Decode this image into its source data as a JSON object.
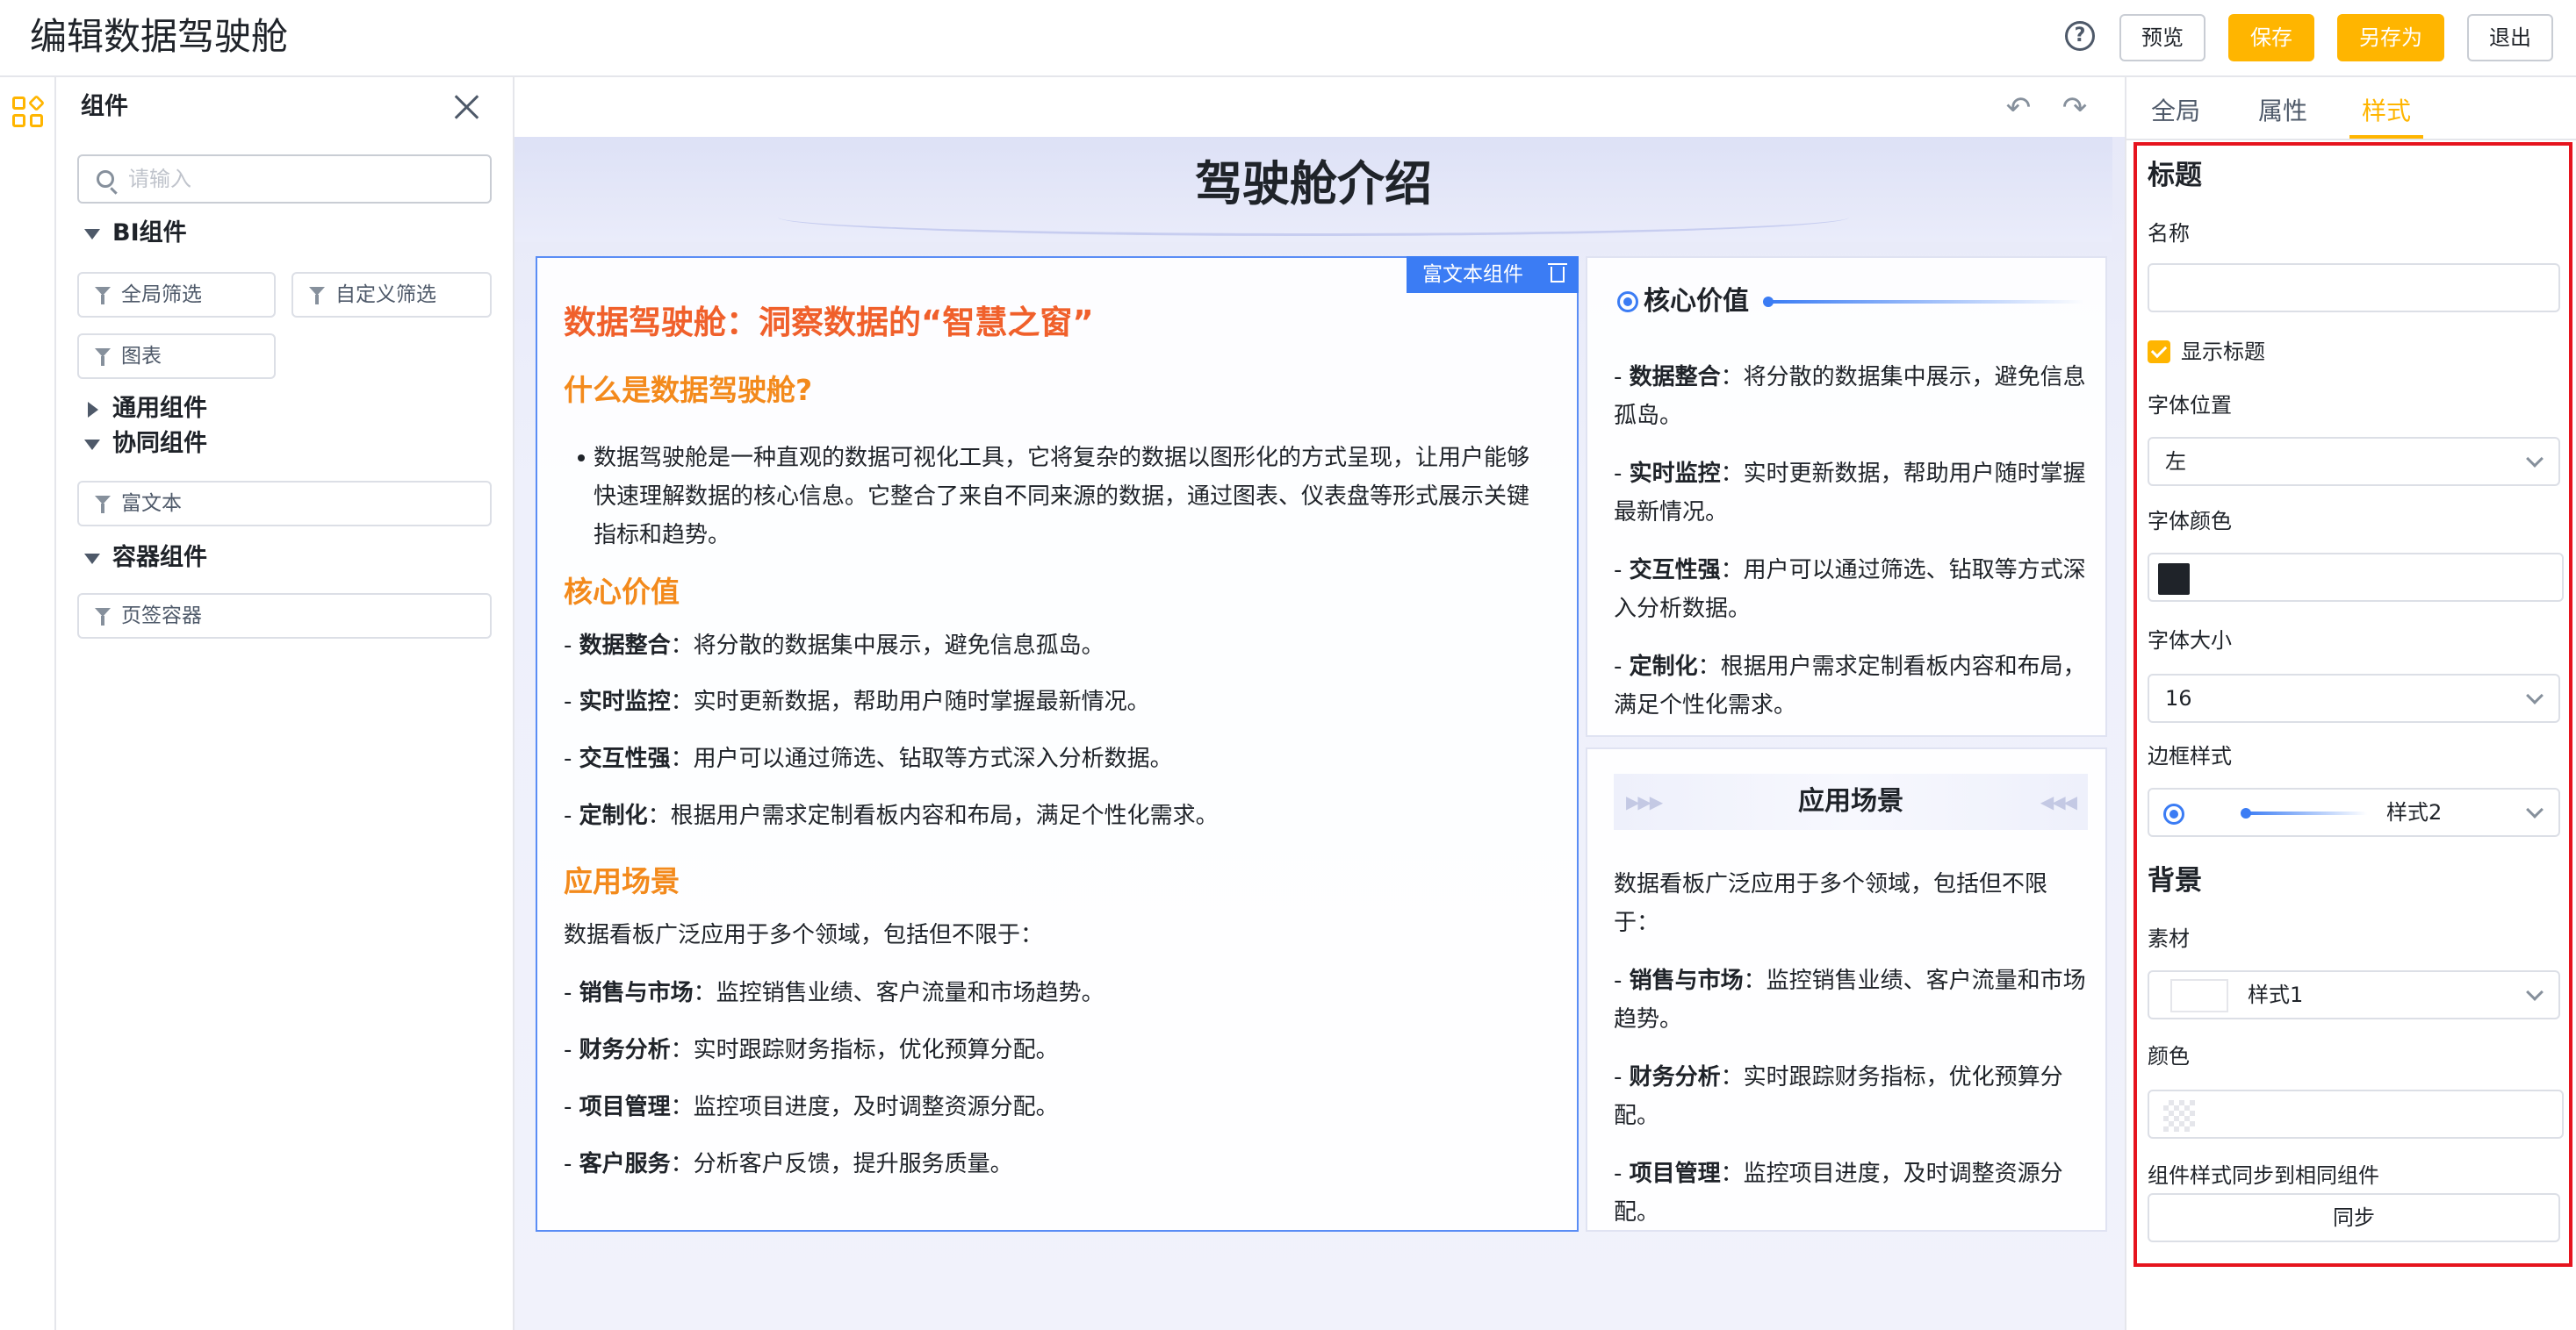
{
  "app": {
    "title": "编辑数据驾驶舱"
  },
  "toolbar": {
    "preview": "预览",
    "save": "保存",
    "save_as": "另存为",
    "exit": "退出"
  },
  "components": {
    "title": "组件",
    "search_placeholder": "请输入",
    "groups": [
      {
        "label": "BI组件",
        "items": [
          "全局筛选",
          "自定义筛选",
          "图表"
        ]
      },
      {
        "label": "通用组件",
        "items": []
      },
      {
        "label": "协同组件",
        "items": [
          "富文本"
        ]
      },
      {
        "label": "容器组件",
        "items": [
          "页签容器"
        ]
      }
    ]
  },
  "canvas": {
    "title": "驾驶舱介绍",
    "rich_tag": "富文本组件",
    "rich": {
      "h1": "数据驾驶舱：洞察数据的“智慧之窗”",
      "h2_what": "什么是数据驾驶舱?",
      "bullet": "数据驾驶舱是一种直观的数据可视化工具，它将复杂的数据以图形化的方式呈现，让用户能够快速理解数据的核心信息。它整合了来自不同来源的数据，通过图表、仪表盘等形式展示关键指标和趋势。",
      "h2_value": "核心价值",
      "values": [
        {
          "k": "数据整合",
          "v": "：将分散的数据集中展示，避免信息孤岛。"
        },
        {
          "k": "实时监控",
          "v": "：实时更新数据，帮助用户随时掌握最新情况。"
        },
        {
          "k": "交互性强",
          "v": "：用户可以通过筛选、钻取等方式深入分析数据。"
        },
        {
          "k": "定制化",
          "v": "：根据用户需求定制看板内容和布局，满足个性化需求。"
        }
      ],
      "h2_scene": "应用场景",
      "scene_intro": "数据看板广泛应用于多个领域，包括但不限于：",
      "scenes": [
        {
          "k": "销售与市场",
          "v": "：监控销售业绩、客户流量和市场趋势。"
        },
        {
          "k": "财务分析",
          "v": "：实时跟踪财务指标，优化预算分配。"
        },
        {
          "k": "项目管理",
          "v": "：监控项目进度，及时调整资源分配。"
        },
        {
          "k": "客户服务",
          "v": "：分析客户反馈，提升服务质量。"
        }
      ]
    },
    "card1": {
      "title": "核心价值",
      "items": [
        {
          "k": "数据整合",
          "v": "：将分散的数据集中展示，避免信息孤岛。"
        },
        {
          "k": "实时监控",
          "v": "：实时更新数据，帮助用户随时掌握最新情况。"
        },
        {
          "k": "交互性强",
          "v": "：用户可以通过筛选、钻取等方式深入分析数据。"
        },
        {
          "k": "定制化",
          "v": "：根据用户需求定制看板内容和布局，满足个性化需求。"
        }
      ]
    },
    "card2": {
      "title": "应用场景",
      "intro": "数据看板广泛应用于多个领域，包括但不限于：",
      "items": [
        {
          "k": "销售与市场",
          "v": "：监控销售业绩、客户流量和市场趋势。"
        },
        {
          "k": "财务分析",
          "v": "：实时跟踪财务指标，优化预算分配。"
        },
        {
          "k": "项目管理",
          "v": "：监控项目进度，及时调整资源分配。"
        }
      ]
    }
  },
  "props": {
    "tabs": [
      "全局",
      "属性",
      "样式"
    ],
    "active_tab": "样式",
    "section_title": "标题",
    "name_label": "名称",
    "name_value": "",
    "show_title": "显示标题",
    "font_pos_label": "字体位置",
    "font_pos_value": "左",
    "font_color_label": "字体颜色",
    "font_color": "#1f2329",
    "font_size_label": "字体大小",
    "font_size_value": "16",
    "border_label": "边框样式",
    "border_value": "样式2",
    "bg_section": "背景",
    "material_label": "素材",
    "material_value": "样式1",
    "color_label": "颜色",
    "sync_label": "组件样式同步到相同组件",
    "sync_button": "同步"
  },
  "colors": {
    "accent": "#ffb500",
    "highlight": "#e6141e",
    "link_blue": "#3b7cf4",
    "heading_orange": "#f38a1c"
  }
}
